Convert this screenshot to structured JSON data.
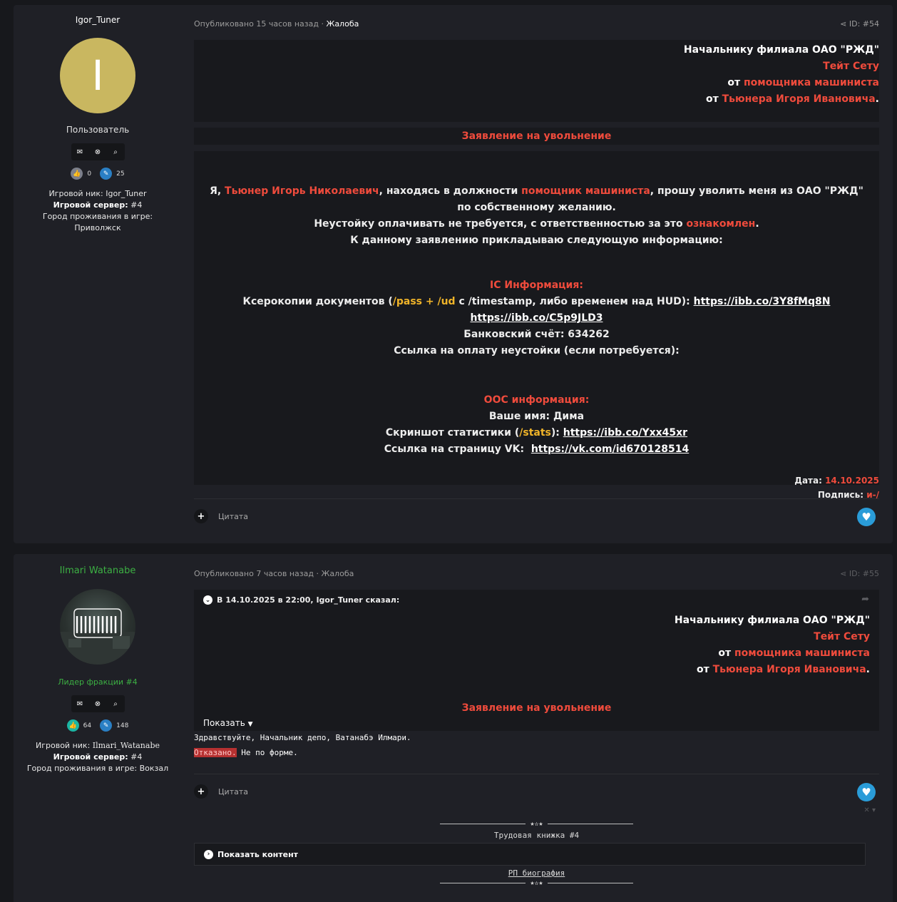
{
  "post1": {
    "author": {
      "name": "Igor_Tuner",
      "avatar_letter": "I",
      "role": "Пользователь",
      "likes": "0",
      "messages": "25",
      "info": {
        "nick_label": "Игровой ник:",
        "nick": "Igor_Tuner",
        "server_label": "Игровой сервер:",
        "server": "#4",
        "city_label": "Город проживания в игре:",
        "city": "Приволжск"
      }
    },
    "meta": {
      "published": "Опубликовано 15 часов назад",
      "sep": "·",
      "category": "Жалоба"
    },
    "post_id": "ID: #54",
    "header": {
      "line1": "Начальнику филиала ОАО \"РЖД\"",
      "line2": "Тейт Сету",
      "line3_prefix": "от",
      "line3": "помощника машиниста",
      "line4_prefix": "от",
      "line4": "Тьюнера Игоря Ивановича",
      "line4_suffix": "."
    },
    "title": "Заявление на увольнение",
    "body": {
      "p1_a": "Я,",
      "p1_name": "Тьюнер Игорь Николаевич",
      "p1_b": ", находясь в должности",
      "p1_pos": "помощник машиниста",
      "p1_c": ", прошу уволить меня из ОАО \"РЖД\" по собственному желанию.",
      "p2_a": "Неустойку оплачивать не требуется, с ответственностью за это",
      "p2_b": "ознакомлен",
      "p2_c": ".",
      "p3": "К данному заявлению прикладываю следующую информацию:",
      "ic_title": "IC Информация:",
      "ic1_a": "Ксерокопии документов (",
      "ic1_cmd": "/pass + /ud",
      "ic1_b": " с /timestamp, либо временем над HUD):",
      "ic1_link1": "https://ibb.co/3Y8fMq8N",
      "ic1_link2": "https://ibb.co/C5p9JLD3",
      "ic2": "Банковский счёт: 634262",
      "ic3": "Ссылка на оплату неустойки (если потребуется):",
      "ooc_title": "ООС информация:",
      "ooc1": "Ваше имя: Дима",
      "ooc2_a": "Скриншот статистики (",
      "ooc2_cmd": "/stats",
      "ooc2_b": "):",
      "ooc2_link": "https://ibb.co/Yxx45xr",
      "ooc3_a": "Ссылка на страницу VK:",
      "ooc3_link": "https://vk.com/id670128514",
      "date_label": "Дата:",
      "date": "14.10.2025",
      "sign_label": "Подпись:",
      "sign": "и-/"
    },
    "quote_label": "Цитата"
  },
  "post2": {
    "author": {
      "name": "Ilmari Watanabe",
      "role": "Лидер фракции #4",
      "likes": "64",
      "messages": "148",
      "info": {
        "nick_label": "Игровой ник:",
        "nick": "Ilmari_Watanabe",
        "server_label": "Игровой сервер:",
        "server": "#4",
        "city_label": "Город проживания в игре:",
        "city": "Вокзал"
      }
    },
    "meta": {
      "published": "Опубликовано 7 часов назад",
      "sep": "·",
      "category": "Жалоба"
    },
    "post_id": "ID: #55",
    "quote": {
      "header": "В 14.10.2025 в 22:00, Igor_Tuner сказал:",
      "line1": "Начальнику филиала ОАО \"РЖД\"",
      "line2": "Тейт Сету",
      "line3_prefix": "от",
      "line3": "помощника машиниста",
      "line4_prefix": "от",
      "line4": "Тьюнера Игоря Ивановича",
      "line4_suffix": ".",
      "title": "Заявление на увольнение",
      "show_more": "Показать"
    },
    "reply_line1": "Здравствуйте, Начальник депо, Ватанабэ Илмари.",
    "reply_denied": "Отказано.",
    "reply_reason": " Не по форме.",
    "quote_label": "Цитата",
    "signature": {
      "ornament": "★✫★",
      "title": "Трудовая книжка #4",
      "spoiler": "Показать контент",
      "bio_link": "РП биография"
    }
  }
}
